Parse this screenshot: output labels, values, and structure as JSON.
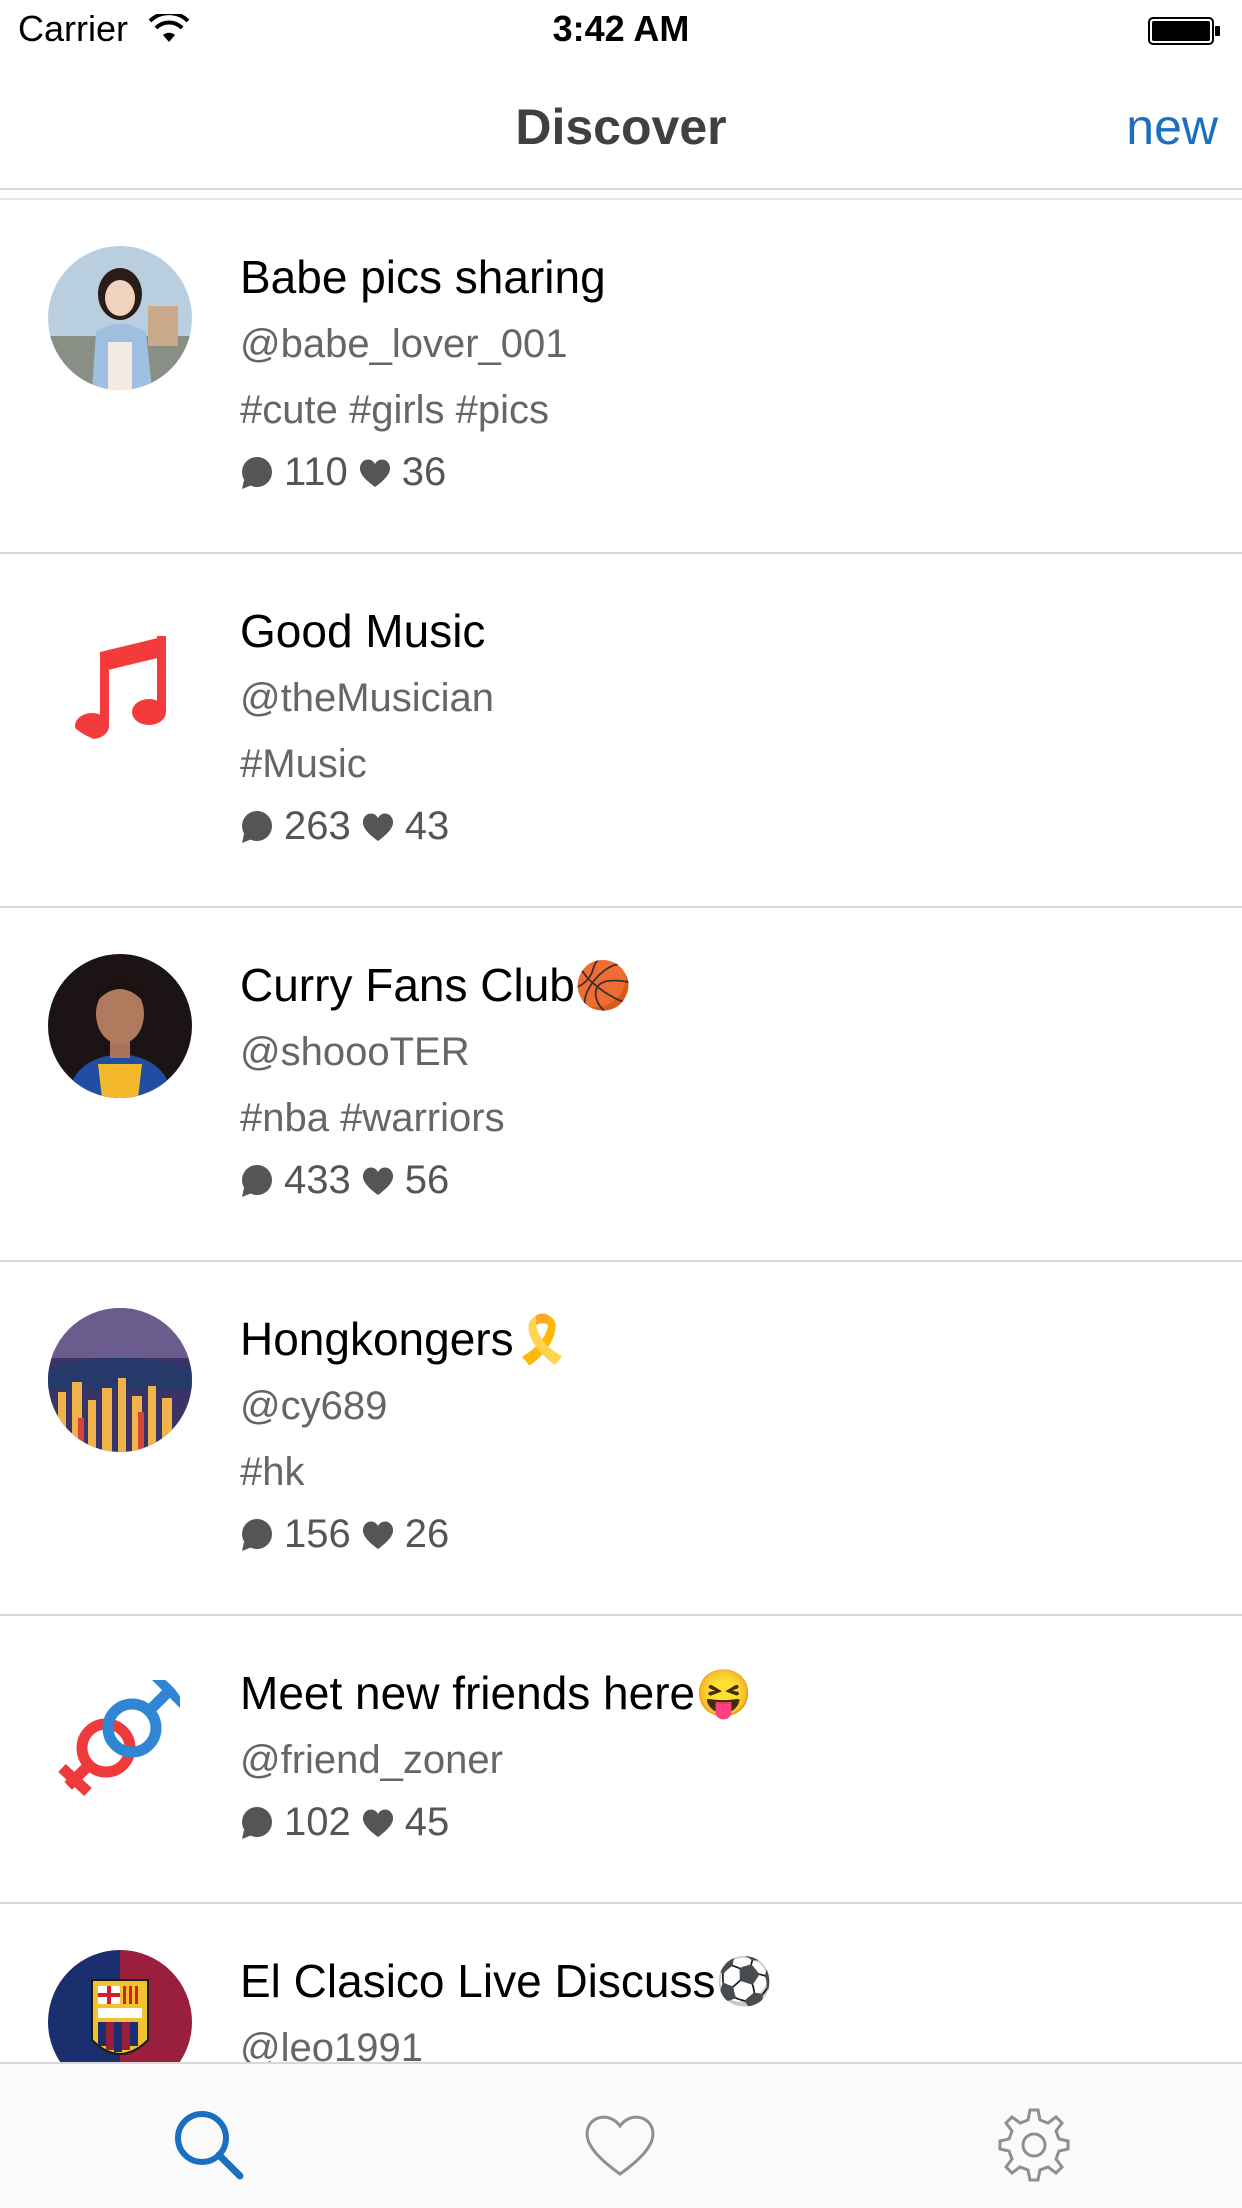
{
  "status_bar": {
    "carrier": "Carrier",
    "time": "3:42 AM"
  },
  "nav": {
    "title": "Discover",
    "action": "new"
  },
  "colors": {
    "accent": "#1c6fc0",
    "divider": "#d8d8d8",
    "secondary_text": "#666666"
  },
  "channels": [
    {
      "title": "Babe pics sharing",
      "user": "@babe_lover_001",
      "tags": "#cute #girls #pics",
      "comments": "110",
      "likes": "36",
      "avatar": "photo-girl"
    },
    {
      "title": "Good Music",
      "user": "@theMusician",
      "tags": "#Music",
      "comments": "263",
      "likes": "43",
      "avatar": "music-note-icon"
    },
    {
      "title": "Curry Fans Club🏀",
      "user": "@shoooTER",
      "tags": "#nba #warriors",
      "comments": "433",
      "likes": "56",
      "avatar": "photo-basketball-player"
    },
    {
      "title": "Hongkongers🎗️",
      "user": "@cy689",
      "tags": "#hk",
      "comments": "156",
      "likes": "26",
      "avatar": "photo-city-night"
    },
    {
      "title": "Meet new friends here😝",
      "user": "@friend_zoner",
      "tags": "",
      "comments": "102",
      "likes": "45",
      "avatar": "gender-symbols-icon"
    },
    {
      "title": "El Clasico Live Discuss⚽",
      "user": "@leo1991",
      "tags": "",
      "comments": "",
      "likes": "",
      "avatar": "fcb-crest"
    }
  ],
  "tabs": [
    {
      "name": "discover",
      "icon": "search-icon",
      "active": true
    },
    {
      "name": "favorites",
      "icon": "heart-icon",
      "active": false
    },
    {
      "name": "settings",
      "icon": "gear-icon",
      "active": false
    }
  ]
}
